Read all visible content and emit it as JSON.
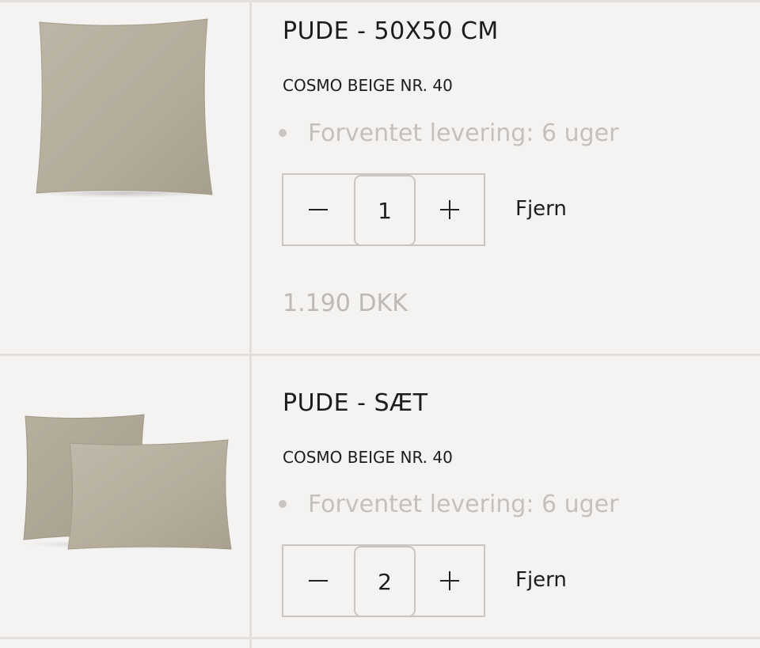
{
  "cart": {
    "items": [
      {
        "title": "PUDE - 50X50 CM",
        "variant": "COSMO BEIGE NR. 40",
        "delivery": "Forventet levering: 6 uger",
        "quantity": "1",
        "minus_icon": "minus-icon",
        "plus_icon": "plus-icon",
        "remove_label": "Fjern",
        "price": "1.190 DKK",
        "image_icon": "square-cushion-image"
      },
      {
        "title": "PUDE - SÆT",
        "variant": "COSMO BEIGE NR. 40",
        "delivery": "Forventet levering: 6 uger",
        "quantity": "2",
        "minus_icon": "minus-icon",
        "plus_icon": "plus-icon",
        "remove_label": "Fjern",
        "image_icon": "cushion-set-image"
      }
    ]
  },
  "colors": {
    "background": "#f5f3f1",
    "divider": "#e3dfda",
    "cushion_fabric": "#b8b09f",
    "muted_text": "#c4c1bd"
  }
}
